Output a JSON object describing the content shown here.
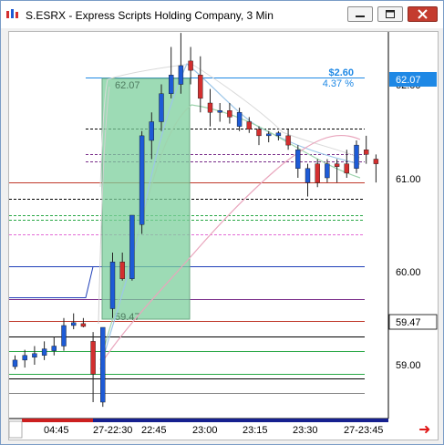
{
  "window": {
    "title": "S.ESRX - Express Scripts Holding Company, 3 Min"
  },
  "chart": {
    "price_axis_labels": [
      "62.00",
      "61.00",
      "60.00",
      "59.00"
    ],
    "time_axis_labels": [
      "04:45",
      "27-22:30",
      "22:45",
      "23:00",
      "23:15",
      "23:30",
      "27-23:45"
    ],
    "last_price_tag": "62.07",
    "low_price_tag": "59.47",
    "range_box_top_label": "62.07",
    "range_box_bottom_label": "59.47",
    "move_amount": "$2.60",
    "move_percent": "4.37 %",
    "scroll_arrow": "➜"
  },
  "chart_data": {
    "type": "candlestick",
    "y_ticks": [
      59.0,
      60.0,
      61.0,
      62.0
    ],
    "range_box": {
      "high": 62.07,
      "low": 59.47
    },
    "candles": [
      {
        "o": 58.98,
        "h": 59.1,
        "l": 58.95,
        "c": 59.05,
        "color": "blue"
      },
      {
        "o": 59.05,
        "h": 59.16,
        "l": 58.97,
        "c": 59.1,
        "color": "blue"
      },
      {
        "o": 59.08,
        "h": 59.2,
        "l": 59.0,
        "c": 59.12,
        "color": "blue"
      },
      {
        "o": 59.1,
        "h": 59.25,
        "l": 59.05,
        "c": 59.17,
        "color": "blue"
      },
      {
        "o": 59.15,
        "h": 59.3,
        "l": 59.1,
        "c": 59.2,
        "color": "blue"
      },
      {
        "o": 59.2,
        "h": 59.5,
        "l": 59.15,
        "c": 59.42,
        "color": "blue"
      },
      {
        "o": 59.42,
        "h": 59.55,
        "l": 59.38,
        "c": 59.45,
        "color": "blue"
      },
      {
        "o": 59.44,
        "h": 59.5,
        "l": 59.4,
        "c": 59.41,
        "color": "red"
      },
      {
        "o": 59.25,
        "h": 59.35,
        "l": 58.6,
        "c": 58.9,
        "color": "red"
      },
      {
        "o": 58.6,
        "h": 59.4,
        "l": 58.55,
        "c": 59.4,
        "color": "blue"
      },
      {
        "o": 59.6,
        "h": 60.2,
        "l": 59.5,
        "c": 60.1,
        "color": "blue"
      },
      {
        "o": 60.1,
        "h": 60.2,
        "l": 59.9,
        "c": 59.92,
        "color": "red"
      },
      {
        "o": 59.92,
        "h": 60.6,
        "l": 59.9,
        "c": 60.6,
        "color": "blue"
      },
      {
        "o": 60.5,
        "h": 61.5,
        "l": 60.4,
        "c": 61.45,
        "color": "blue"
      },
      {
        "o": 61.4,
        "h": 61.7,
        "l": 61.2,
        "c": 61.6,
        "color": "blue"
      },
      {
        "o": 61.6,
        "h": 62.0,
        "l": 61.5,
        "c": 61.9,
        "color": "blue"
      },
      {
        "o": 61.9,
        "h": 62.4,
        "l": 61.85,
        "c": 62.1,
        "color": "blue"
      },
      {
        "o": 62.0,
        "h": 62.55,
        "l": 61.9,
        "c": 62.2,
        "color": "blue"
      },
      {
        "o": 62.25,
        "h": 62.4,
        "l": 62.0,
        "c": 62.15,
        "color": "red"
      },
      {
        "o": 62.1,
        "h": 62.3,
        "l": 61.7,
        "c": 61.85,
        "color": "red"
      },
      {
        "o": 61.8,
        "h": 61.95,
        "l": 61.55,
        "c": 61.7,
        "color": "red"
      },
      {
        "o": 61.7,
        "h": 61.8,
        "l": 61.6,
        "c": 61.72,
        "color": "blue"
      },
      {
        "o": 61.72,
        "h": 61.8,
        "l": 61.58,
        "c": 61.65,
        "color": "red"
      },
      {
        "o": 61.55,
        "h": 61.75,
        "l": 61.5,
        "c": 61.7,
        "color": "blue"
      },
      {
        "o": 61.6,
        "h": 61.65,
        "l": 61.48,
        "c": 61.52,
        "color": "red"
      },
      {
        "o": 61.52,
        "h": 61.55,
        "l": 61.35,
        "c": 61.45,
        "color": "red"
      },
      {
        "o": 61.45,
        "h": 61.5,
        "l": 61.38,
        "c": 61.47,
        "color": "blue"
      },
      {
        "o": 61.45,
        "h": 61.5,
        "l": 61.4,
        "c": 61.48,
        "color": "blue"
      },
      {
        "o": 61.45,
        "h": 61.52,
        "l": 61.3,
        "c": 61.35,
        "color": "red"
      },
      {
        "o": 61.3,
        "h": 61.35,
        "l": 61.0,
        "c": 61.1,
        "color": "blue"
      },
      {
        "o": 61.1,
        "h": 61.15,
        "l": 60.8,
        "c": 60.95,
        "color": "blue"
      },
      {
        "o": 60.95,
        "h": 61.2,
        "l": 60.9,
        "c": 61.15,
        "color": "red"
      },
      {
        "o": 61.15,
        "h": 61.2,
        "l": 60.95,
        "c": 61.0,
        "color": "blue"
      },
      {
        "o": 61.12,
        "h": 61.2,
        "l": 60.95,
        "c": 61.15,
        "color": "red"
      },
      {
        "o": 61.05,
        "h": 61.3,
        "l": 61.0,
        "c": 61.15,
        "color": "red"
      },
      {
        "o": 61.1,
        "h": 61.4,
        "l": 61.05,
        "c": 61.35,
        "color": "blue"
      },
      {
        "o": 61.3,
        "h": 61.45,
        "l": 61.15,
        "c": 61.25,
        "color": "red"
      },
      {
        "o": 61.2,
        "h": 61.25,
        "l": 60.95,
        "c": 61.15,
        "color": "red"
      }
    ],
    "horizontal_lines": [
      {
        "price": 62.07,
        "color": "#1e88e5",
        "style": "solid"
      },
      {
        "price": 61.53,
        "color": "#000000",
        "style": "dashed"
      },
      {
        "price": 61.25,
        "color": "#7a2d8a",
        "style": "dashed"
      },
      {
        "price": 61.18,
        "color": "#7a2d8a",
        "style": "dashed"
      },
      {
        "price": 60.95,
        "color": "#c0392b",
        "style": "solid"
      },
      {
        "price": 60.78,
        "color": "#000000",
        "style": "dashed"
      },
      {
        "price": 60.6,
        "color": "#28a745",
        "style": "dashed"
      },
      {
        "price": 60.55,
        "color": "#28a745",
        "style": "dashed"
      },
      {
        "price": 60.4,
        "color": "#e46bd6",
        "style": "dashed"
      },
      {
        "price": 60.05,
        "color": "#1f3fb8",
        "style": "solid"
      },
      {
        "price": 59.7,
        "color": "#7a2d8a",
        "style": "solid"
      },
      {
        "price": 59.47,
        "color": "#c0392b",
        "style": "solid"
      },
      {
        "price": 59.3,
        "color": "#000000",
        "style": "solid"
      },
      {
        "price": 59.15,
        "color": "#28a745",
        "style": "solid"
      },
      {
        "price": 58.9,
        "color": "#28a745",
        "style": "solid"
      },
      {
        "price": 58.85,
        "color": "#000000",
        "style": "solid"
      },
      {
        "price": 58.7,
        "color": "#8a8a8a",
        "style": "solid"
      }
    ]
  }
}
